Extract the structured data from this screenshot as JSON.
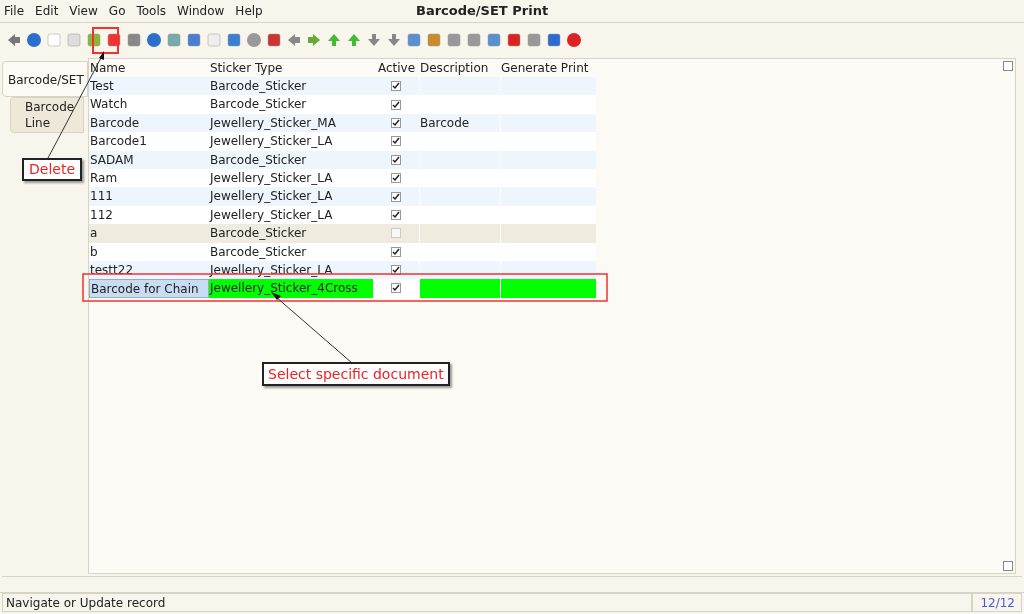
{
  "window": {
    "title": "Barcode/SET Print"
  },
  "menu": [
    "File",
    "Edit",
    "View",
    "Go",
    "Tools",
    "Window",
    "Help"
  ],
  "tabs": [
    {
      "label": "Barcode/SET",
      "selected": true
    },
    {
      "label": "Barcode Line",
      "selected": false
    }
  ],
  "table": {
    "columns": [
      "Name",
      "Sticker Type",
      "Active",
      "Description",
      "Generate Print"
    ],
    "rows": [
      {
        "name": "Test",
        "sticker_type": "Barcode_Sticker",
        "active": true,
        "description": "",
        "selected": false
      },
      {
        "name": "Watch",
        "sticker_type": "Barcode_Sticker",
        "active": true,
        "description": "",
        "selected": false
      },
      {
        "name": "Barcode",
        "sticker_type": "Jewellery_Sticker_MA",
        "active": true,
        "description": "Barcode",
        "selected": false
      },
      {
        "name": "Barcode1",
        "sticker_type": "Jewellery_Sticker_LA",
        "active": true,
        "description": "",
        "selected": false
      },
      {
        "name": "SADAM",
        "sticker_type": "Barcode_Sticker",
        "active": true,
        "description": "",
        "selected": false
      },
      {
        "name": "Ram",
        "sticker_type": "Jewellery_Sticker_LA",
        "active": true,
        "description": "",
        "selected": false
      },
      {
        "name": "111",
        "sticker_type": "Jewellery_Sticker_LA",
        "active": true,
        "description": "",
        "selected": false
      },
      {
        "name": "112",
        "sticker_type": "Jewellery_Sticker_LA",
        "active": true,
        "description": "",
        "selected": false
      },
      {
        "name": "a",
        "sticker_type": "Barcode_Sticker",
        "active": false,
        "description": "",
        "selected": false
      },
      {
        "name": "b",
        "sticker_type": "Barcode_Sticker",
        "active": true,
        "description": "",
        "selected": false
      },
      {
        "name": "testt22",
        "sticker_type": "Jewellery_Sticker_LA",
        "active": true,
        "description": "",
        "selected": false
      },
      {
        "name": "Barcode for Chain",
        "sticker_type": "Jewellery_Sticker_4Cross",
        "active": true,
        "description": "",
        "selected": true
      }
    ]
  },
  "annotations": [
    {
      "label": "Delete"
    },
    {
      "label": "Select specific document"
    }
  ],
  "status_bar": {
    "message": "Navigate or Update record",
    "count": "12/12"
  }
}
